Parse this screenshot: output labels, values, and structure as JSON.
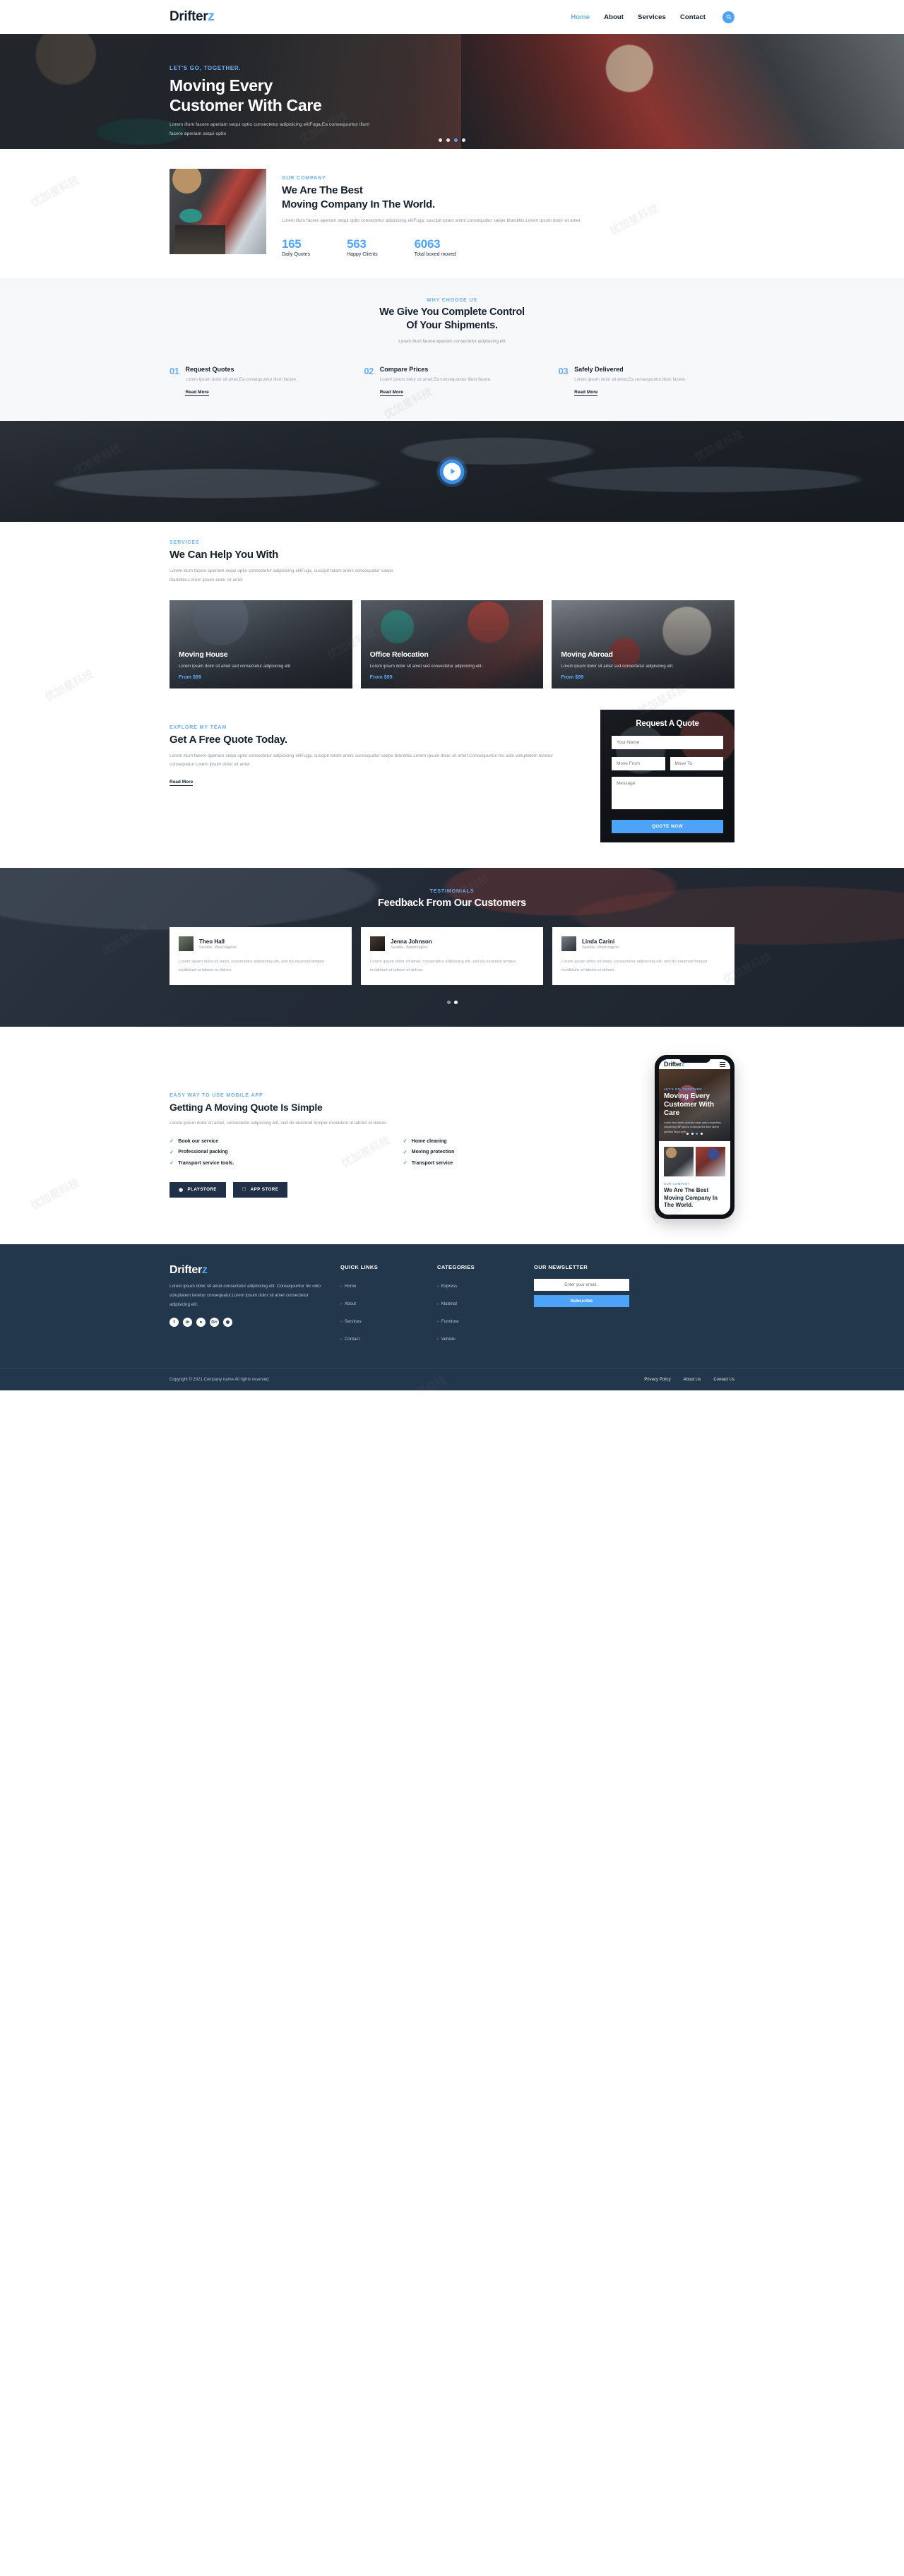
{
  "brand": {
    "name": "Drifter",
    "accent_letter": "z",
    "accent_color": "#4da3f7"
  },
  "header": {
    "nav": [
      {
        "label": "Home",
        "active": true
      },
      {
        "label": "About",
        "active": false
      },
      {
        "label": "Services",
        "active": false
      },
      {
        "label": "Contact",
        "active": false
      }
    ],
    "search_icon": "search-icon"
  },
  "hero": {
    "kicker": "LET'S GO, TOGETHER.",
    "title_line1": "Moving Every",
    "title_line2": "Customer With Care",
    "subtitle": "Lorem illum facere aperiam sequi optio consectetur adipisicing elitFuga,Ea consequuntur illum facere aperiam sequi optio",
    "slides": 4,
    "active_slide": 3
  },
  "about": {
    "kicker": "OUR COMPANY",
    "title_line1": "We Are The Best",
    "title_line2": "Moving Company In The World.",
    "description": "Lorem illum facere aperiam sequi optio consectetur adipisicing elitFuga, suscipit totam animi consequatur saepe blanditiis.Lorem ipsum dolor sit amet",
    "stats": [
      {
        "number": "165",
        "label": "Daily Quotes"
      },
      {
        "number": "563",
        "label": "Happy Clients"
      },
      {
        "number": "6063",
        "label": "Total boxed moved"
      }
    ]
  },
  "why": {
    "kicker": "WHY CHOOSE US",
    "title_line1": "We Give You Complete Control",
    "title_line2": "Of Your Shipments.",
    "description": "Lorem illum facere aperiam consectetur adipisicing elit",
    "items": [
      {
        "num": "01",
        "title": "Request Quotes",
        "text": "Lorem ipsum dolor sit amet,Ea consequuntur illum facere.",
        "link": "Read More"
      },
      {
        "num": "02",
        "title": "Compare Prices",
        "text": "Lorem ipsum dolor sit amet,Ea consequuntur illum facere.",
        "link": "Read More"
      },
      {
        "num": "03",
        "title": "Safely Delivered",
        "text": "Lorem ipsum dolor sit amet,Ea consequuntur illum facere.",
        "link": "Read More"
      }
    ]
  },
  "video": {
    "play_icon": "play-icon"
  },
  "services": {
    "kicker": "SERVICES",
    "title": "We Can Help You With",
    "description": "Lorem illum facere aperiam sequi optio consectetur adipisicing elitFuga, suscipit totam animi consequatur saepe blanditiis.Lorem ipsum dolor sit amet",
    "cards": [
      {
        "title": "Moving House",
        "text": "Lorem ipsum dolor sit amet sed consectetur adipisicing elit.",
        "price": "From $99"
      },
      {
        "title": "Office Relocation",
        "text": "Lorem ipsum dolor sit amet sed consectetur adipisicing elit..",
        "price": "From $99"
      },
      {
        "title": "Moving Abroad",
        "text": "Lorem ipsum dolor sit amet sed consectetur adipisicing elit.",
        "price": "From $99"
      }
    ]
  },
  "quote": {
    "kicker": "EXPLORE MY TEAM",
    "title": "Get A Free Quote Today.",
    "description": "Lorem illum facere aperiam sequi optio consectetur adipisicing elitFuga, suscipit totam animi consequatur saepe blanditiis.Lorem ipsum dolor sit amet.Consequuntur hic odio voluptatem tenetur consequatur.Lorem ipsum dolor sit amet",
    "link": "Read More",
    "form": {
      "title": "Request A Quote",
      "name_placeholder": "Your Name",
      "from_placeholder": "Move From",
      "to_placeholder": "Move To",
      "message_placeholder": "Message",
      "submit_label": "QUOTE NOW"
    }
  },
  "testimonials": {
    "kicker": "TESTIMONIALS",
    "title": "Feedback From Our Customers",
    "cards": [
      {
        "name": "Theo Hall",
        "location": "Seattle, Washington",
        "text": "Lorem ipsum dolor sit amet, consectetur adipiscing elit, sed do eiusmod tempor incididunt ut labore et dolore."
      },
      {
        "name": "Jenna Johnson",
        "location": "Seattle, Washington",
        "text": "Lorem ipsum dolor sit amet, consectetur adipiscing elit, sed do eiusmod tempor incididunt ut labore et dolore."
      },
      {
        "name": "Linda Carini",
        "location": "Seattle, Washington",
        "text": "Lorem ipsum dolor sit amet, consectetur adipiscing elit, sed do eiusmod tempor incididunt ut labore et dolore."
      }
    ],
    "slides": 2,
    "active_slide": 2
  },
  "app": {
    "kicker": "EASY WAY TO USE MOBILE APP",
    "title": "Getting A Moving Quote Is Simple",
    "description": "Lorem ipsum dolor sit amet, consectetur adipiscing elit, sed do eiusmod tempor incididunt ut labore et dolore.",
    "features": [
      "Book our service",
      "Home cleaning",
      "Professional packing",
      "Moving protection",
      "Transport service tools.",
      "Transport service"
    ],
    "buttons": [
      {
        "label": "PLAYSTORE",
        "icon": "playstore-icon",
        "glyph": "◉"
      },
      {
        "label": "APP STORE",
        "icon": "apple-icon",
        "glyph": ""
      }
    ],
    "phone": {
      "logo": "Drifter",
      "logo_accent": "z",
      "hero_kicker": "LET'S GO, TOGETHER",
      "hero_title": "Moving Every Customer With Care",
      "hero_sub": "Lorem illum facere aperiam sequi optio consectetur adipisicing elitFuga,Ea consequuntur illum facere aperiam sequi optio",
      "section_kicker": "OUR COMPANY",
      "section_title": "We Are The Best Moving Company In The World."
    }
  },
  "footer": {
    "description": "Lorem ipsum dolor sit amet consectetur adipisicing elit. Consequuntur hic odio voluptatem tenetur consequatur.Lorem ipsum dolor sit amet consectetur adipisicing elit.",
    "socials": [
      {
        "name": "facebook-icon",
        "glyph": "f"
      },
      {
        "name": "linkedin-icon",
        "glyph": "in"
      },
      {
        "name": "twitter-icon",
        "glyph": "ᵗ"
      },
      {
        "name": "google-plus-icon",
        "glyph": "G+"
      },
      {
        "name": "github-icon",
        "glyph": "◔"
      }
    ],
    "columns": [
      {
        "heading": "QUICK LINKS",
        "links": [
          "Home",
          "About",
          "Services",
          "Contact"
        ]
      },
      {
        "heading": "CATEGORIES",
        "links": [
          "Express",
          "Material",
          "Furniture",
          "Vehicle"
        ]
      }
    ],
    "newsletter": {
      "heading": "OUR NEWSLETTER",
      "placeholder": "Enter your email..",
      "button": "Subscribe"
    },
    "copyright": "Copyright © 2021.Company name All rights reserved.",
    "bottom_links": [
      "Privacy Policy",
      "About Us",
      "Contact Us"
    ]
  }
}
